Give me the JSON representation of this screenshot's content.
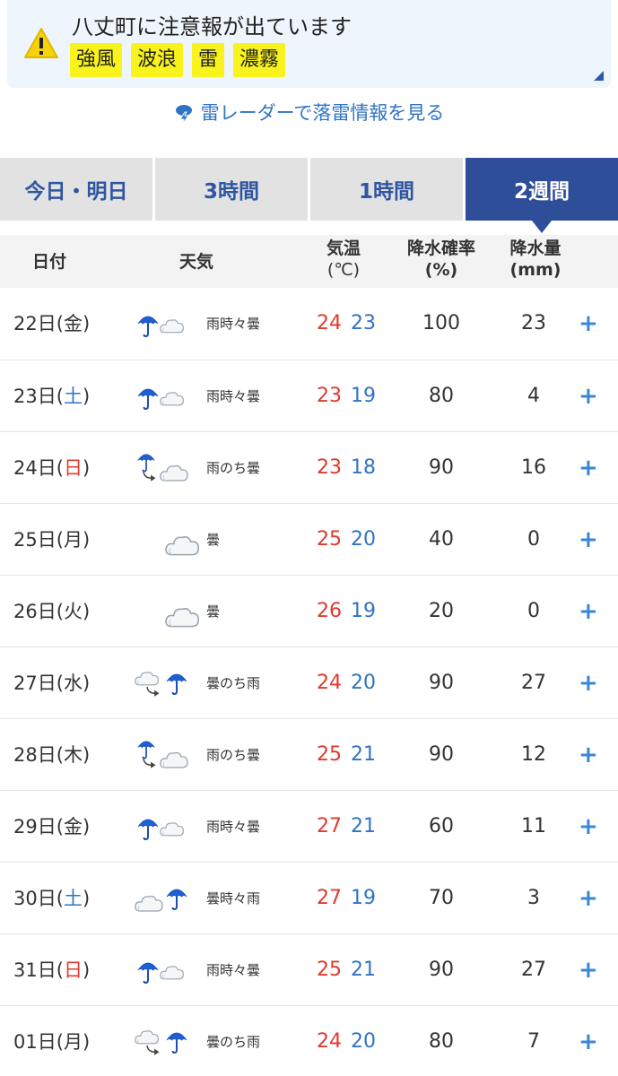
{
  "alert": {
    "title": "八丈町に注意報が出ています",
    "tags": [
      "強風",
      "波浪",
      "雷",
      "濃霧"
    ]
  },
  "radar_link": "雷レーダーで落雷情報を見る",
  "tabs": [
    {
      "label": "今日・明日",
      "active": false
    },
    {
      "label": "3時間",
      "active": false
    },
    {
      "label": "1時間",
      "active": false
    },
    {
      "label": "2週間",
      "active": true
    }
  ],
  "table": {
    "headers": {
      "date": "日付",
      "weather": "天気",
      "temp": "気温",
      "temp_unit": "(℃)",
      "prob": "降水確率",
      "prob_unit": "(%)",
      "amount": "降水量",
      "amount_unit": "(mm)"
    },
    "rows": [
      {
        "day": "22日",
        "dow": "(金)",
        "dow_color": "normal",
        "icon": "rain-sometimes-cloudy-icon",
        "weather": "雨時々曇",
        "hi": "24",
        "lo": "23",
        "prob": "100",
        "amount": "23",
        "expand": "+"
      },
      {
        "day": "23日",
        "dow": "(土)",
        "dow_color": "sat",
        "icon": "rain-sometimes-cloudy-icon",
        "weather": "雨時々曇",
        "hi": "23",
        "lo": "19",
        "prob": "80",
        "amount": "4",
        "expand": "+"
      },
      {
        "day": "24日",
        "dow": "(日)",
        "dow_color": "sun",
        "icon": "rain-then-cloudy-icon",
        "weather": "雨のち曇",
        "hi": "23",
        "lo": "18",
        "prob": "90",
        "amount": "16",
        "expand": "+"
      },
      {
        "day": "25日",
        "dow": "(月)",
        "dow_color": "normal",
        "icon": "cloudy-icon",
        "weather": "曇",
        "hi": "25",
        "lo": "20",
        "prob": "40",
        "amount": "0",
        "expand": "+"
      },
      {
        "day": "26日",
        "dow": "(火)",
        "dow_color": "normal",
        "icon": "cloudy-icon",
        "weather": "曇",
        "hi": "26",
        "lo": "19",
        "prob": "20",
        "amount": "0",
        "expand": "+"
      },
      {
        "day": "27日",
        "dow": "(水)",
        "dow_color": "normal",
        "icon": "cloudy-then-rain-icon",
        "weather": "曇のち雨",
        "hi": "24",
        "lo": "20",
        "prob": "90",
        "amount": "27",
        "expand": "+"
      },
      {
        "day": "28日",
        "dow": "(木)",
        "dow_color": "normal",
        "icon": "rain-then-cloudy-icon",
        "weather": "雨のち曇",
        "hi": "25",
        "lo": "21",
        "prob": "90",
        "amount": "12",
        "expand": "+"
      },
      {
        "day": "29日",
        "dow": "(金)",
        "dow_color": "normal",
        "icon": "rain-sometimes-cloudy-icon",
        "weather": "雨時々曇",
        "hi": "27",
        "lo": "21",
        "prob": "60",
        "amount": "11",
        "expand": "+"
      },
      {
        "day": "30日",
        "dow": "(土)",
        "dow_color": "sat",
        "icon": "cloudy-sometimes-rain-icon",
        "weather": "曇時々雨",
        "hi": "27",
        "lo": "19",
        "prob": "70",
        "amount": "3",
        "expand": "+"
      },
      {
        "day": "31日",
        "dow": "(日)",
        "dow_color": "sun",
        "icon": "rain-sometimes-cloudy-icon",
        "weather": "雨時々曇",
        "hi": "25",
        "lo": "21",
        "prob": "90",
        "amount": "27",
        "expand": "+"
      },
      {
        "day": "01日",
        "dow": "(月)",
        "dow_color": "normal",
        "icon": "cloudy-then-rain-icon",
        "weather": "曇のち雨",
        "hi": "24",
        "lo": "20",
        "prob": "80",
        "amount": "7",
        "expand": "+"
      }
    ]
  },
  "colors": {
    "high_temp": "#e03a2e",
    "low_temp": "#2f74c4",
    "active_tab": "#2e4e9a",
    "alert_tag": "#f8f31d"
  }
}
